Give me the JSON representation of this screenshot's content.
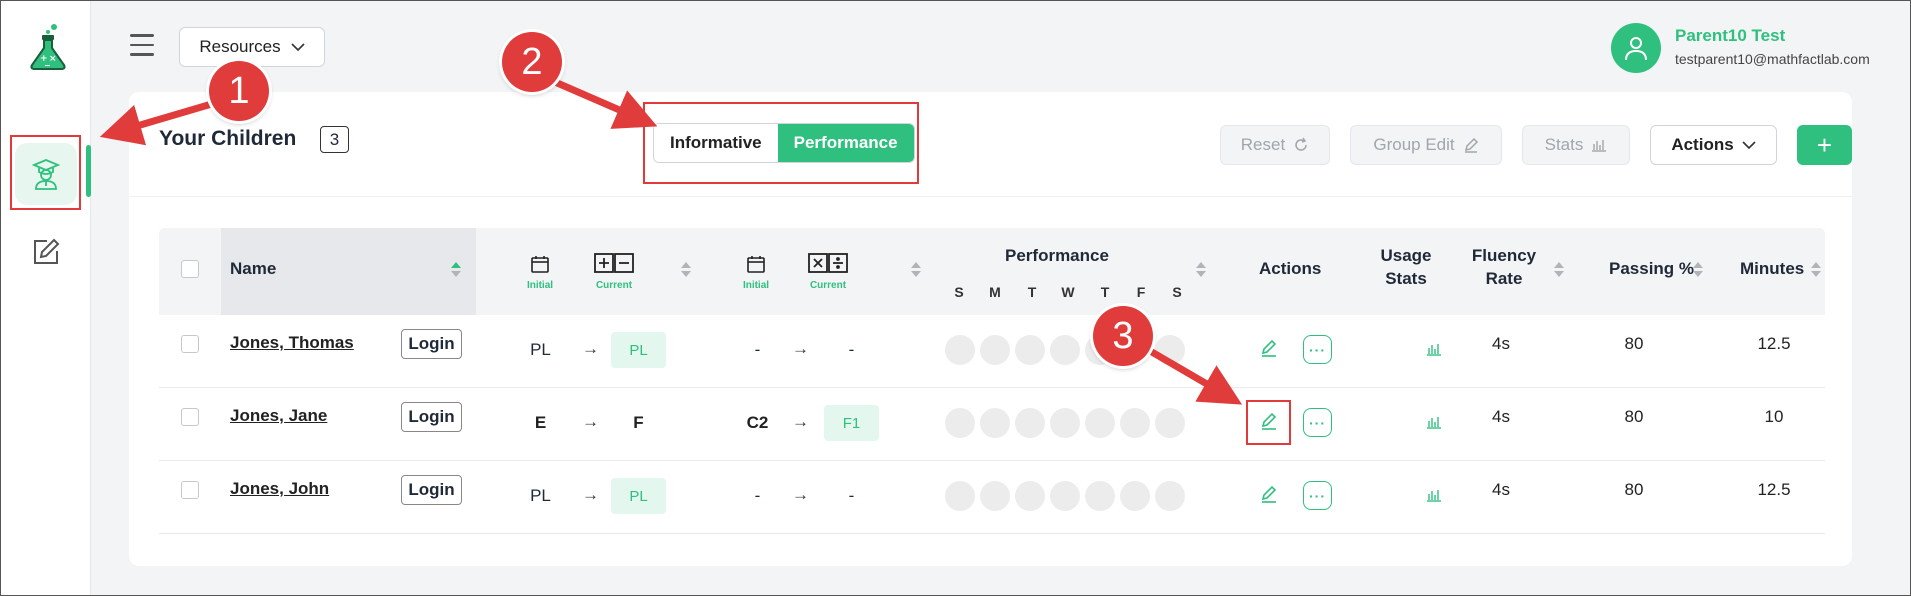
{
  "header": {
    "resources_label": "Resources",
    "user_name": "Parent10 Test",
    "user_email": "testparent10@mathfactlab.com"
  },
  "card": {
    "title": "Your Children",
    "count": "3",
    "view_toggle": {
      "informative": "Informative",
      "performance": "Performance"
    },
    "toolbar": {
      "reset": "Reset",
      "group_edit": "Group Edit",
      "stats": "Stats",
      "actions": "Actions",
      "add": "+"
    }
  },
  "table": {
    "headers": {
      "name": "Name",
      "initial": "Initial",
      "current": "Current",
      "performance": "Performance",
      "days": [
        "S",
        "M",
        "T",
        "W",
        "T",
        "F",
        "S"
      ],
      "actions": "Actions",
      "usage_stats_1": "Usage",
      "usage_stats_2": "Stats",
      "fluency_1": "Fluency",
      "fluency_2": "Rate",
      "passing": "Passing %",
      "minutes": "Minutes"
    },
    "login_label": "Login",
    "rows": [
      {
        "name": "Jones, Thomas",
        "add_initial": "PL",
        "add_current": "PL",
        "mul_initial": "-",
        "mul_current": "-",
        "fluency": "4s",
        "passing": "80",
        "minutes": "12.5"
      },
      {
        "name": "Jones, Jane",
        "add_initial": "E",
        "add_current": "F",
        "mul_initial": "C2",
        "mul_current": "F1",
        "fluency": "4s",
        "passing": "80",
        "minutes": "10"
      },
      {
        "name": "Jones, John",
        "add_initial": "PL",
        "add_current": "PL",
        "mul_initial": "-",
        "mul_current": "-",
        "fluency": "4s",
        "passing": "80",
        "minutes": "12.5"
      }
    ]
  },
  "annotations": {
    "m1": "1",
    "m2": "2",
    "m3": "3"
  },
  "colors": {
    "accent": "#2fc07f",
    "annotation": "#e13c3c"
  }
}
